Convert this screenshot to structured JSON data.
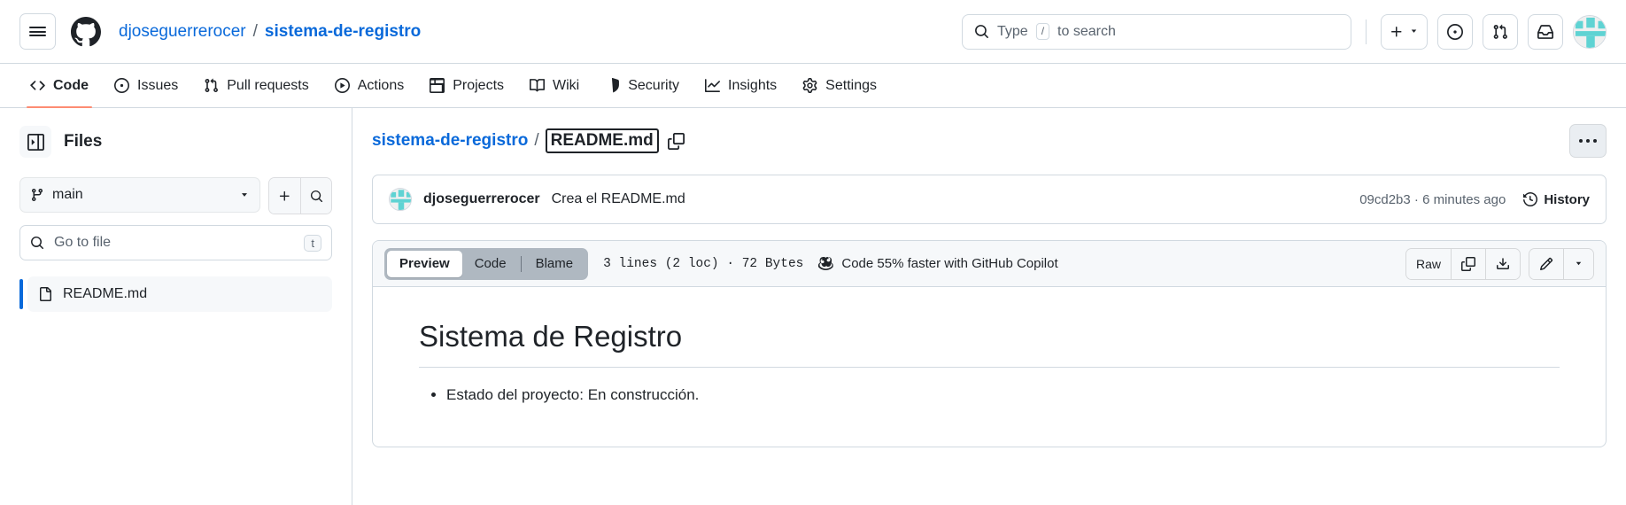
{
  "header": {
    "menu_icon": "hamburger-icon",
    "logo_icon": "github-logo-icon",
    "owner": "djoseguerrerocer",
    "separator": "/",
    "repo": "sistema-de-registro",
    "search": {
      "icon": "search-icon",
      "placeholder_prefix": "Type",
      "key_hint": "/",
      "placeholder_suffix": "to search"
    },
    "actions": [
      {
        "name": "create-new-button",
        "icon": "plus-icon",
        "caret": true
      },
      {
        "name": "issues-button",
        "icon": "issue-opened-icon"
      },
      {
        "name": "pull-requests-button",
        "icon": "git-pull-request-icon"
      },
      {
        "name": "notifications-button",
        "icon": "inbox-icon"
      }
    ],
    "avatar_label": "avatar"
  },
  "repo_nav": {
    "items": [
      {
        "label": "Code",
        "icon": "code-icon",
        "active": true
      },
      {
        "label": "Issues",
        "icon": "issue-opened-icon",
        "active": false
      },
      {
        "label": "Pull requests",
        "icon": "git-pull-request-icon",
        "active": false
      },
      {
        "label": "Actions",
        "icon": "play-icon",
        "active": false
      },
      {
        "label": "Projects",
        "icon": "table-icon",
        "active": false
      },
      {
        "label": "Wiki",
        "icon": "book-icon",
        "active": false
      },
      {
        "label": "Security",
        "icon": "shield-icon",
        "active": false
      },
      {
        "label": "Insights",
        "icon": "graph-icon",
        "active": false
      },
      {
        "label": "Settings",
        "icon": "gear-icon",
        "active": false
      }
    ]
  },
  "sidebar": {
    "title": "Files",
    "panel_icon": "sidebar-collapse-icon",
    "branch": {
      "name": "main",
      "icon": "git-branch-icon",
      "caret_icon": "chevron-down-icon"
    },
    "add_button_icon": "plus-icon",
    "search_button_icon": "search-icon",
    "go_to_file": {
      "placeholder": "Go to file",
      "icon": "search-icon",
      "shortcut": "t"
    },
    "files": [
      {
        "name": "README.md",
        "icon": "file-icon",
        "selected": true
      }
    ]
  },
  "main": {
    "breadcrumb": {
      "repo": "sistema-de-registro",
      "separator": "/",
      "filename": "README.md",
      "copy_icon": "copy-icon"
    },
    "kebab_label": "more-options",
    "commit": {
      "author": "djoseguerrerocer",
      "message": "Crea el README.md",
      "sha": "09cd2b3",
      "time": "6 minutes ago",
      "meta": "09cd2b3 · 6 minutes ago",
      "history_label": "History",
      "history_icon": "history-icon"
    },
    "file_toolbar": {
      "views": [
        {
          "label": "Preview",
          "active": true
        },
        {
          "label": "Code",
          "active": false
        },
        {
          "label": "Blame",
          "active": false
        }
      ],
      "stats": "3 lines (2 loc) · 72 Bytes",
      "copilot": {
        "icon": "copilot-icon",
        "text": "Code 55% faster with GitHub Copilot"
      },
      "raw_label": "Raw",
      "copy_icon": "copy-icon",
      "download_icon": "download-icon",
      "edit_icon": "pencil-icon",
      "edit_caret_icon": "chevron-down-icon"
    },
    "readme": {
      "heading": "Sistema de Registro",
      "items": [
        "Estado del proyecto: En construcción."
      ]
    }
  },
  "colors": {
    "accent": "#0969da",
    "active_tab_underline": "#fd8c73",
    "border": "#d1d9e0",
    "canvas_subtle": "#f6f8fa",
    "avatar_teal": "#5fd3d3"
  }
}
